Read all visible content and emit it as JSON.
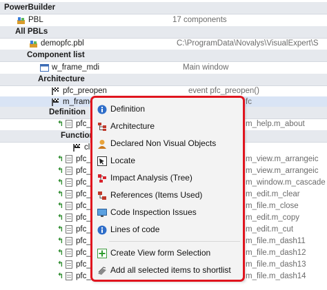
{
  "tree": {
    "root": "PowerBuilder",
    "pbl": {
      "label": "PBL",
      "desc": "17 components"
    },
    "all_pbls": "All PBLs",
    "demopfc": {
      "label": "demopfc.pbl",
      "desc": "C:\\ProgramData\\Novalys\\VisualExpert\\S"
    },
    "component_list": "Component list",
    "w_frame": {
      "label": "w_frame_mdi",
      "desc": "Main window"
    },
    "architecture": "Architecture",
    "pfc_preopen": {
      "label": "pfc_preopen",
      "desc": "event pfc_preopen()"
    },
    "m_frame": {
      "label": "m_frame",
      "desc": "fc"
    },
    "definition": "Definition",
    "r1": {
      "label": "pfc_",
      "desc": "m_help.m_about"
    },
    "function": "Function",
    "cl": {
      "label": "cl"
    },
    "rows": [
      {
        "label": "pfc_",
        "desc": "m_view.m_arrangeic"
      },
      {
        "label": "pfc_",
        "desc": "m_view.m_arrangeic"
      },
      {
        "label": "pfc_",
        "desc": "m_window.m_cascade"
      },
      {
        "label": "pfc_",
        "desc": "m_edit.m_clear"
      },
      {
        "label": "pfc_",
        "desc": "m_file.m_close"
      },
      {
        "label": "pfc_",
        "desc": "m_edit.m_copy"
      },
      {
        "label": "pfc_",
        "desc": "m_edit.m_cut"
      },
      {
        "label": "pfc_",
        "desc": "m_file.m_dash11"
      },
      {
        "label": "pfc_",
        "desc": "m_file.m_dash12"
      },
      {
        "label": "pfc_",
        "desc": "m_file.m_dash13"
      },
      {
        "label": "pfc_",
        "desc": "m_file.m_dash14"
      }
    ]
  },
  "menu": {
    "items": [
      {
        "label": "Definition",
        "icon": "info-icon"
      },
      {
        "label": "Architecture",
        "icon": "architecture-icon"
      },
      {
        "label": "Declared Non Visual Objects",
        "icon": "person-icon"
      },
      {
        "label": "Locate",
        "icon": "locate-icon"
      },
      {
        "label": "Impact Analysis (Tree)",
        "icon": "impact-icon"
      },
      {
        "label": "References (Items Used)",
        "icon": "references-icon"
      },
      {
        "label": "Code Inspection Issues",
        "icon": "monitor-icon"
      },
      {
        "label": "Lines of code",
        "icon": "info-icon"
      },
      {
        "label": "Create View form Selection",
        "icon": "green-plus-icon"
      },
      {
        "label": "Add all selected items to shortlist",
        "icon": "shortlist-icon"
      }
    ]
  },
  "colors": {
    "highlight_frame": "#e0141e",
    "section_header_bg": "#e6e9ee",
    "selected_row_bg": "#d9e4f5"
  }
}
